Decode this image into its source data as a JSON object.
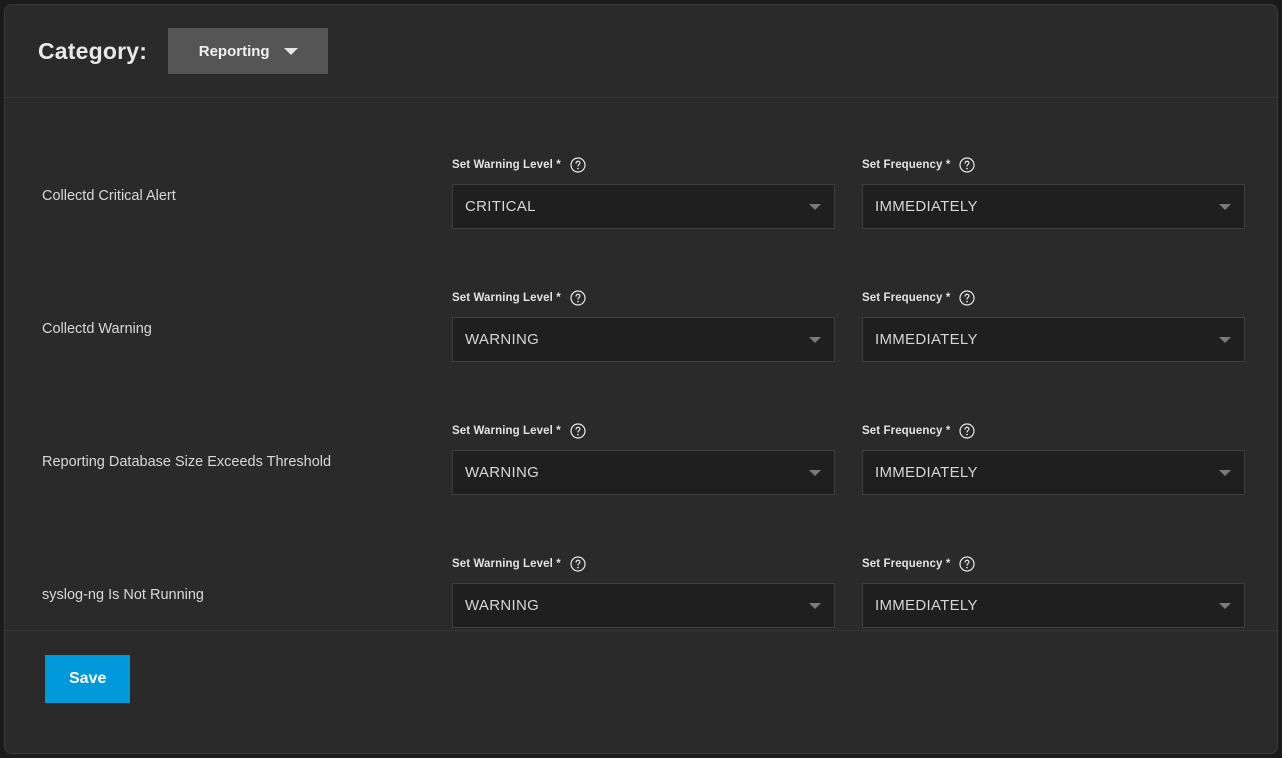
{
  "header": {
    "title": "Category:",
    "category_button": {
      "label": "Reporting",
      "icon": "chevron-down-icon"
    }
  },
  "colors": {
    "accent": "#0099db",
    "panel_background": "#2a2a2a",
    "page_background": "#1b1b1b",
    "select_background": "#1f1f1f",
    "select_border": "#3f3f3f",
    "category_button_background": "#555555",
    "divider": "#363636",
    "text_primary": "#e2e2e2",
    "text_value": "#d6d6d6"
  },
  "field_labels": {
    "warning_level": "Set Warning Level *",
    "frequency": "Set Frequency *",
    "help_icon": "help-circle-icon",
    "dropdown_icon": "caret-down-icon"
  },
  "rows": [
    {
      "name": "Collectd Critical Alert",
      "warning_level": "CRITICAL",
      "frequency": "IMMEDIATELY"
    },
    {
      "name": "Collectd Warning",
      "warning_level": "WARNING",
      "frequency": "IMMEDIATELY"
    },
    {
      "name": "Reporting Database Size Exceeds Threshold",
      "warning_level": "WARNING",
      "frequency": "IMMEDIATELY"
    },
    {
      "name": "syslog-ng Is Not Running",
      "warning_level": "WARNING",
      "frequency": "IMMEDIATELY"
    }
  ],
  "footer": {
    "save_label": "Save"
  }
}
